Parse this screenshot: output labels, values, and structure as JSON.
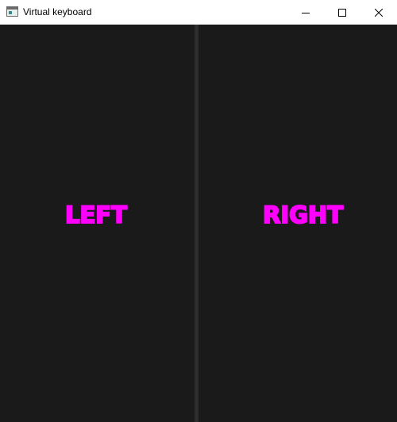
{
  "window": {
    "title": "Virtual keyboard",
    "icon": "app-window-icon",
    "controls": {
      "minimize_icon": "minimize-icon",
      "maximize_icon": "maximize-icon",
      "close_icon": "close-icon"
    }
  },
  "panes": {
    "left": {
      "label": "LEFT"
    },
    "right": {
      "label": "RIGHT"
    }
  },
  "colors": {
    "background": "#1a1a1a",
    "divider": "#2e2e2e",
    "label": "#ff00ff",
    "titlebar": "#ffffff"
  }
}
